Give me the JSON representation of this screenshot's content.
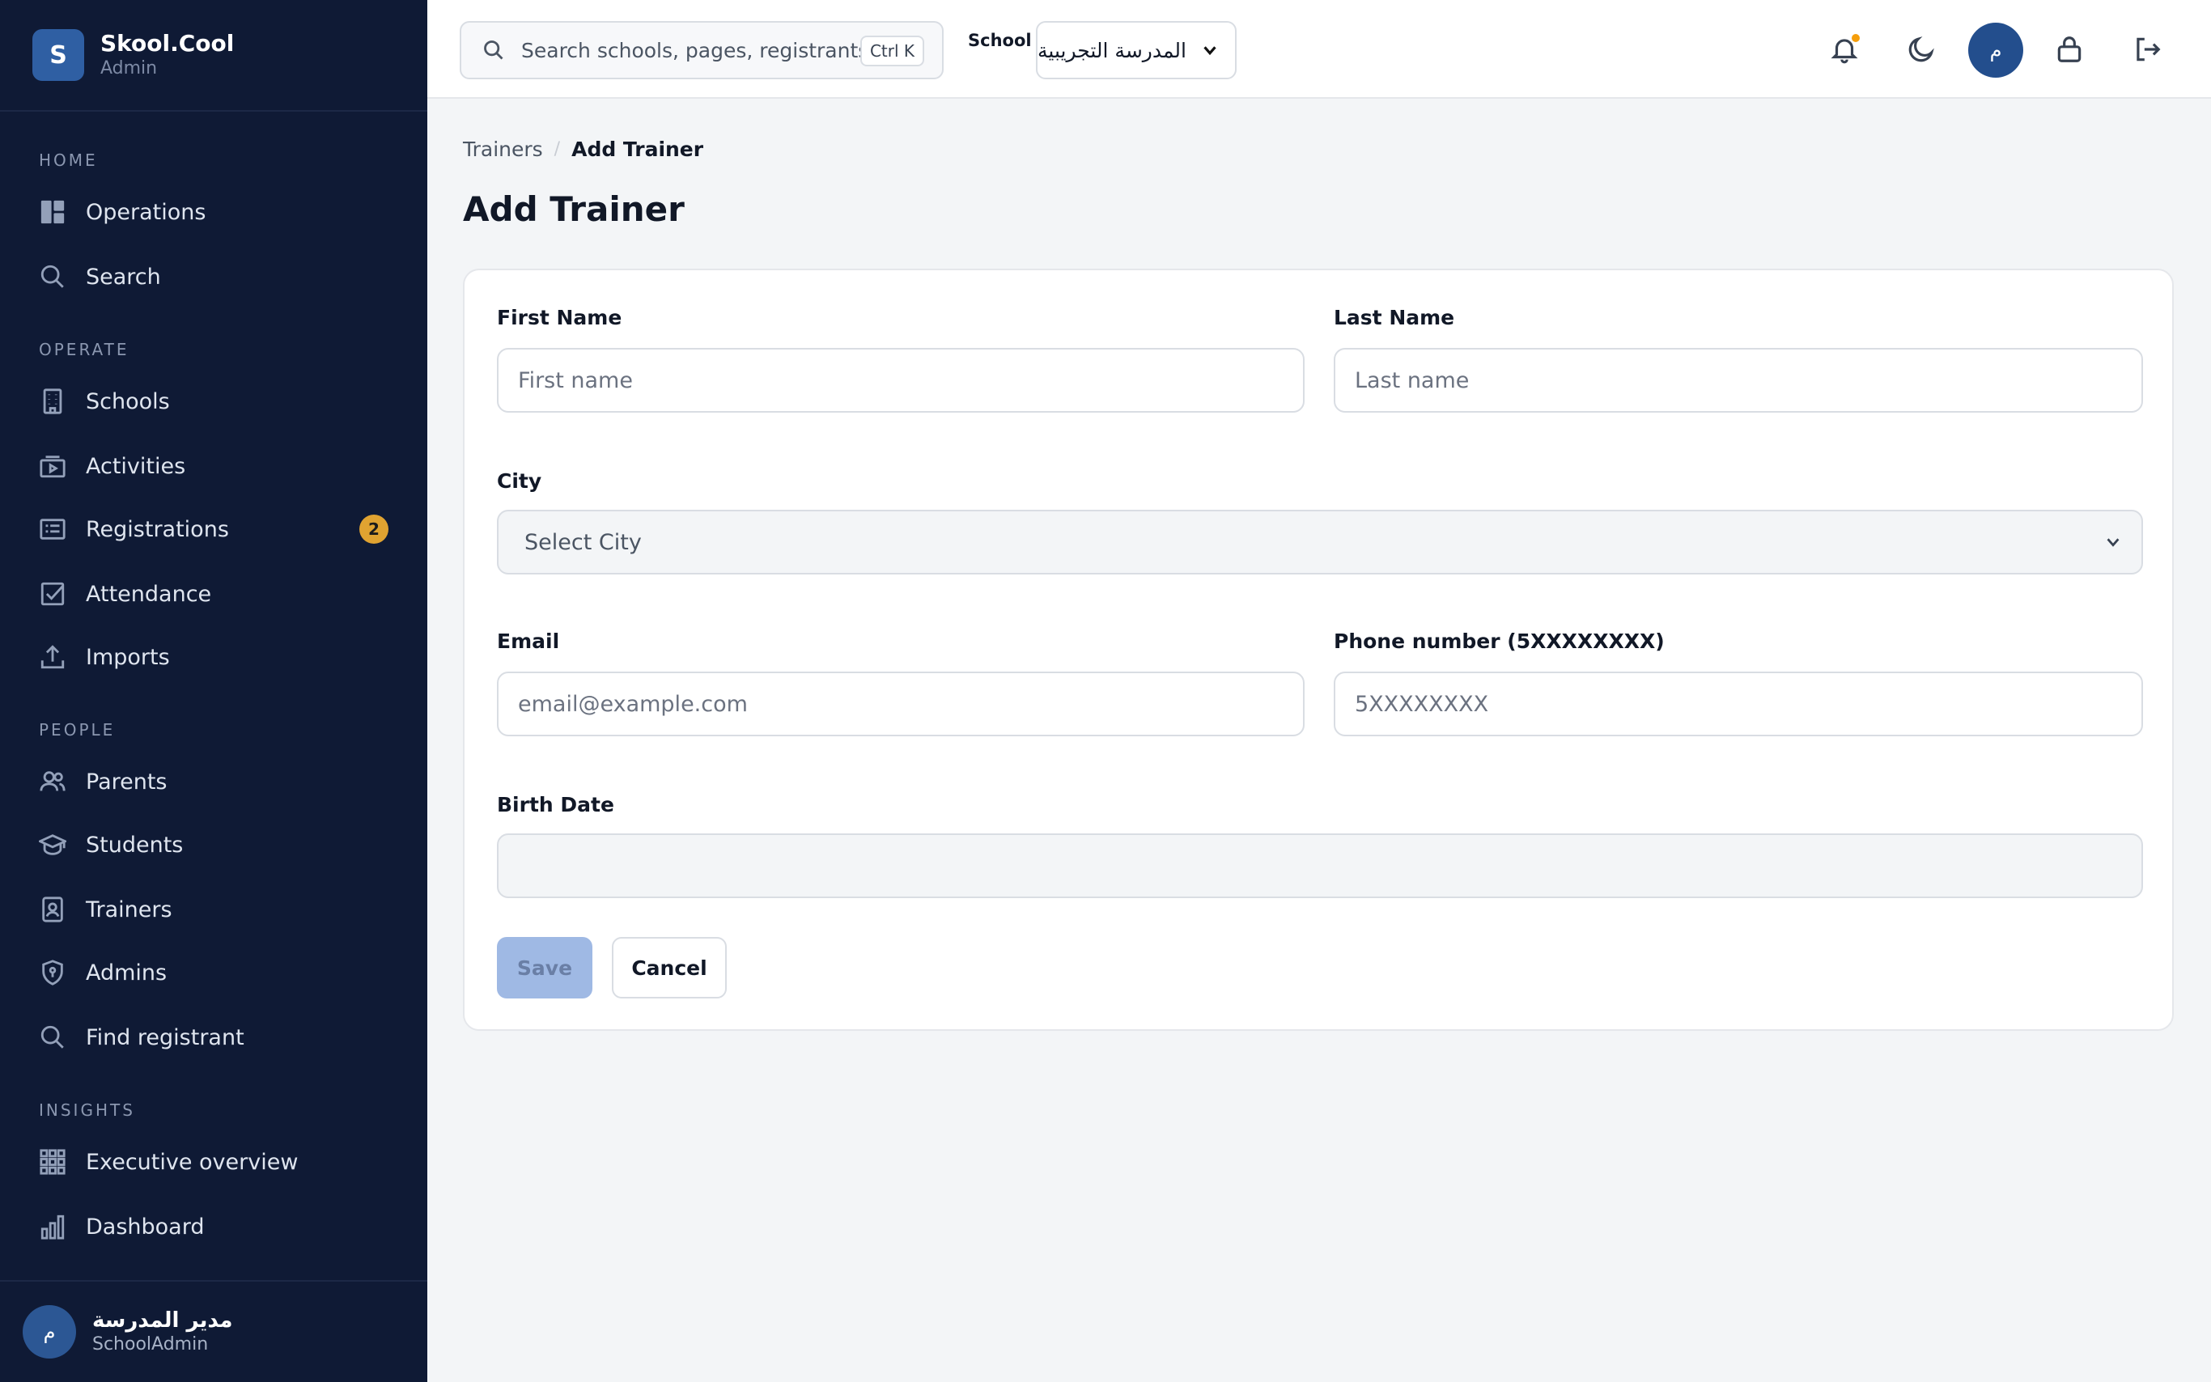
{
  "brand": {
    "initial": "S",
    "name": "Skool.Cool",
    "role": "Admin"
  },
  "sidebar": {
    "sections": {
      "home": "HOME",
      "operate": "OPERATE",
      "people": "PEOPLE",
      "insights": "INSIGHTS"
    },
    "items": [
      {
        "label": "Operations",
        "icon": "dashboard-icon"
      },
      {
        "label": "Search",
        "icon": "search-icon"
      },
      {
        "label": "Schools",
        "icon": "building-icon"
      },
      {
        "label": "Activities",
        "icon": "activities-icon"
      },
      {
        "label": "Registrations",
        "icon": "registrations-icon",
        "badge": "2"
      },
      {
        "label": "Attendance",
        "icon": "checkbox-icon"
      },
      {
        "label": "Imports",
        "icon": "upload-icon"
      },
      {
        "label": "Parents",
        "icon": "users-icon"
      },
      {
        "label": "Students",
        "icon": "graduation-cap-icon"
      },
      {
        "label": "Trainers",
        "icon": "id-badge-icon"
      },
      {
        "label": "Admins",
        "icon": "shield-icon"
      },
      {
        "label": "Find registrant",
        "icon": "search-icon"
      },
      {
        "label": "Executive overview",
        "icon": "grid-icon"
      },
      {
        "label": "Dashboard",
        "icon": "bar-chart-icon"
      }
    ],
    "user": {
      "initial": "م",
      "name": "مدير المدرسة",
      "role": "SchoolAdmin"
    }
  },
  "header": {
    "search_placeholder": "Search schools, pages, registrants...",
    "shortcut": "Ctrl K",
    "school_label": "School",
    "school_value": "المدرسة التجريبية",
    "avatar_initial": "م",
    "notification_dot_color": "#f59e0b"
  },
  "breadcrumb": {
    "parent": "Trainers",
    "separator": "/",
    "current": "Add Trainer"
  },
  "page_title": "Add Trainer",
  "form": {
    "first_name": {
      "label": "First Name",
      "placeholder": "First name"
    },
    "last_name": {
      "label": "Last Name",
      "placeholder": "Last name"
    },
    "city": {
      "label": "City",
      "placeholder": "Select City"
    },
    "email": {
      "label": "Email",
      "placeholder": "email@example.com"
    },
    "phone": {
      "label": "Phone number (5XXXXXXXX)",
      "placeholder": "5XXXXXXXX"
    },
    "birth_date": {
      "label": "Birth Date",
      "value": ""
    },
    "save_label": "Save",
    "cancel_label": "Cancel"
  },
  "colors": {
    "sidebar_bg": "#0f1a35",
    "accent": "#234e8d",
    "badge": "#e0a331",
    "save_disabled": "#9fb9e4"
  }
}
